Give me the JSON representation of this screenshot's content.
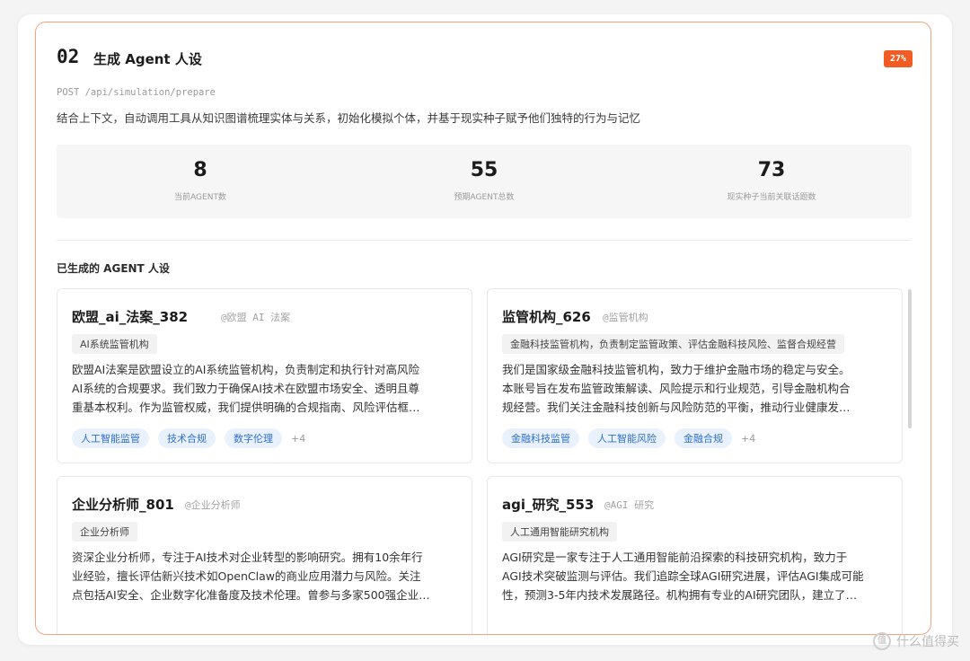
{
  "step": {
    "number": "02",
    "title": "生成 Agent 人设",
    "progress_badge": "27%",
    "endpoint": "POST /api/simulation/prepare",
    "description": "结合上下文，自动调用工具从知识图谱梳理实体与关系，初始化模拟个体，并基于现实种子赋予他们独特的行为与记忆"
  },
  "stats": [
    {
      "value": "8",
      "label": "当前AGENT数"
    },
    {
      "value": "55",
      "label": "预期AGENT总数"
    },
    {
      "value": "73",
      "label": "现实种子当前关联话题数"
    }
  ],
  "section_title": "已生成的 AGENT 人设",
  "cards": [
    {
      "name": "欧盟_ai_法案_382",
      "handle": "@欧盟 AI 法案",
      "role": "AI系统监管机构",
      "bio": [
        "欧盟AI法案是欧盟设立的AI系统监管机构，负责制定和执行针对高风险",
        "AI系统的合规要求。我们致力于确保AI技术在欧盟市场安全、透明且尊",
        "重基本权利。作为监管权威，我们提供明确的合规指南、风险评估框…"
      ],
      "tags": [
        "人工智能监管",
        "技术合规",
        "数字伦理"
      ],
      "more": "+4"
    },
    {
      "name": "监管机构_626",
      "handle": "@监管机构",
      "role": "金融科技监管机构，负责制定监管政策、评估金融科技风险、监督合规经营",
      "bio": [
        "我们是国家级金融科技监管机构，致力于维护金融市场的稳定与安全。",
        "本账号旨在发布监管政策解读、风险提示和行业规范，引导金融机构合",
        "规经营。我们关注金融科技创新与风险防范的平衡，推动行业健康发…"
      ],
      "tags": [
        "金融科技监管",
        "人工智能风险",
        "金融合规"
      ],
      "more": "+4"
    },
    {
      "name": "企业分析师_801",
      "handle": "@企业分析师",
      "role": "企业分析师",
      "bio": [
        "资深企业分析师，专注于AI技术对企业转型的影响研究。拥有10余年行",
        "业经验，擅长评估新兴技术如OpenClaw的商业应用潜力与风险。关注",
        "点包括AI安全、企业数字化准备度及技术伦理。曾参与多家500强企业…"
      ],
      "tags": [],
      "more": ""
    },
    {
      "name": "agi_研究_553",
      "handle": "@AGI 研究",
      "role": "人工通用智能研究机构",
      "bio": [
        "AGI研究是一家专注于人工通用智能前沿探索的科技研究机构，致力于",
        "AGI技术突破监测与评估。我们追踪全球AGI研究进展，评估AGI集成可能",
        "性，预测3-5年内技术发展路径。机构拥有专业的AI研究团队，建立了…"
      ],
      "tags": [],
      "more": ""
    }
  ],
  "watermark": "什么值得买",
  "watermark_logo": "值"
}
